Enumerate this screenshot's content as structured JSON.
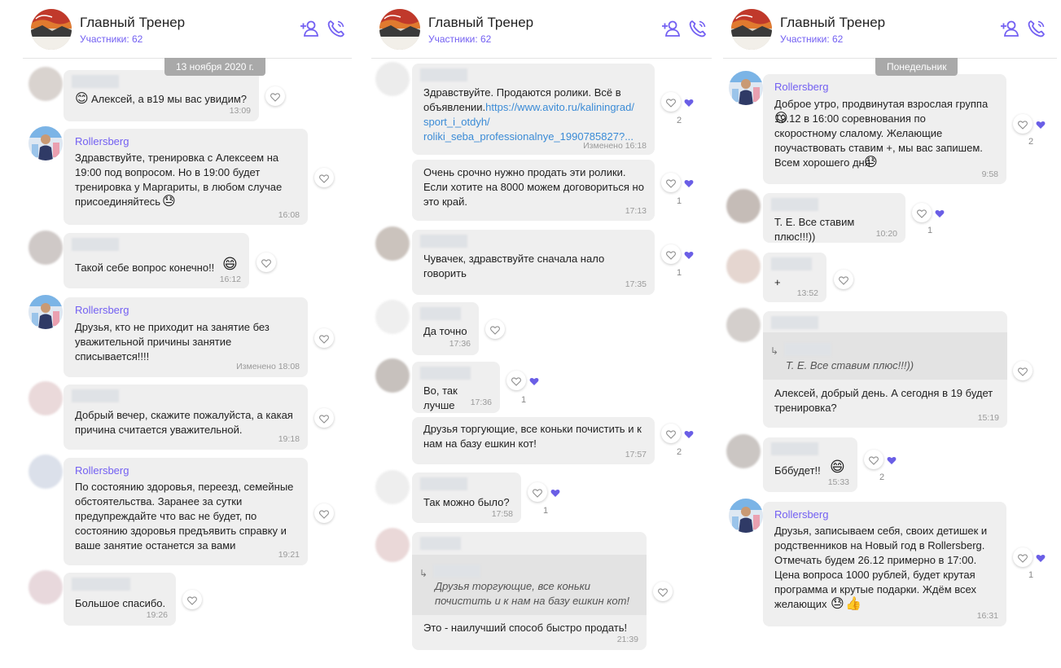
{
  "chat": {
    "title": "Главный Тренер",
    "members": "Участники: 62"
  },
  "colors": {
    "accent": "#7360f2",
    "bubble": "#efefef",
    "date_pill": "#a9a9a9",
    "link": "#3b8bd6"
  },
  "icons": {
    "add_member": "add-person-icon",
    "call": "phone-icon",
    "like": "heart-outline-icon",
    "liked": "heart-filled-icon"
  },
  "panel1": {
    "date": "13 ноября 2020 г.",
    "m1": {
      "text": "Алексей,  а в19 мы вас увидим?",
      "time": "13:09"
    },
    "m2": {
      "sender": "Rollersberg",
      "text": "Здравствуйте, тренировка с Алексеем на\n19:00 под вопросом. Но в 19:00 будет\nтренировка у Маргариты, в любом случае\nприсоединяйтесь",
      "time": "16:08"
    },
    "m3": {
      "text": "Такой себе вопрос конечно!!",
      "time": "16:12"
    },
    "m4": {
      "sender": "Rollersberg",
      "text": "Друзья, кто не приходит на занятие без\nуважительной причины занятие\nсписывается!!!!",
      "time": "Изменено 18:08"
    },
    "m5": {
      "text": "Добрый вечер, скажите пожалуйста, а какая\nпричина считается уважительной.",
      "time": "19:18"
    },
    "m6": {
      "sender": "Rollersberg",
      "text": "По состоянию здоровья, переезд, семейные\nобстоятельства. Заранее за сутки\nпредупреждайте что вас не будет, по\nсостоянию здоровья предъявить справку и\nваше занятие останется за вами",
      "time": "19:21"
    },
    "m7": {
      "text": "Большое спасибо.",
      "time": "19:26"
    }
  },
  "panel2": {
    "m1": {
      "text_before": "Здравствуйте. Продаются ролики. Всё в\nобъявлении.",
      "link": "https://www.avito.ru/kaliningrad/\nsport_i_otdyh/\nroliki_seba_professionalnye_1990785827?...",
      "time": "Изменено 16:18",
      "likes": "2"
    },
    "m2": {
      "text": "Очень срочно нужно продать эти ролики.\nЕсли хотите на 8000 можем договориться но\nэто край.",
      "time": "17:13",
      "likes": "1"
    },
    "m3": {
      "text": "Чувачек, здравствуйте сначала нало\nговорить",
      "time": "17:35",
      "likes": "1"
    },
    "m4": {
      "text": "Да точно",
      "time": "17:36"
    },
    "m5": {
      "text": "Во, так лучше",
      "time": "17:36",
      "likes": "1"
    },
    "m6": {
      "text": "Друзья торгующие, все коньки почистить и к\nнам на базу ешкин кот!",
      "time": "17:57",
      "likes": "2"
    },
    "m7": {
      "text": "Так можно было?",
      "time": "17:58",
      "likes": "1"
    },
    "m8": {
      "quote": "Друзья торгующие, все коньки\nпочистить и к нам на базу ешкин кот!",
      "text": "Это - наилучший способ быстро продать!",
      "time": "21:39"
    }
  },
  "panel3": {
    "date": "Понедельник",
    "m1": {
      "sender": "Rollersberg",
      "text": "Доброе утро, продвинутая взрослая группа\n     19.12 в 16:00 соревнования по\nскоростному слалому. Желающие\nпоучаствовать ставим +, мы вас запишем.\nВсем хорошего дня",
      "time": "9:58",
      "likes": "2"
    },
    "m2": {
      "text": "Т. Е. Все ставим плюс!!!))",
      "time": "10:20",
      "likes": "1"
    },
    "m3": {
      "text": "+",
      "time": "13:52"
    },
    "m4": {
      "quote": "Т. Е. Все ставим плюс!!!))",
      "text": "Алексей,  добрый день. А сегодня в 19 будет\nтренировка?",
      "time": "15:19"
    },
    "m5": {
      "text": "Бббудет!!",
      "time": "15:33",
      "likes": "2"
    },
    "m6": {
      "sender": "Rollersberg",
      "text": "Друзья, записываем себя, своих детишек и\nродственников на Новый год в Rollersberg.\nОтмечать будем 26.12 примерно в 17:00.\nЦена вопроса 1000 рублей, будет крутая\nпрограмма и крутые подарки. Ждём всех\nжелающих",
      "time": "16:31",
      "likes": "1"
    }
  }
}
